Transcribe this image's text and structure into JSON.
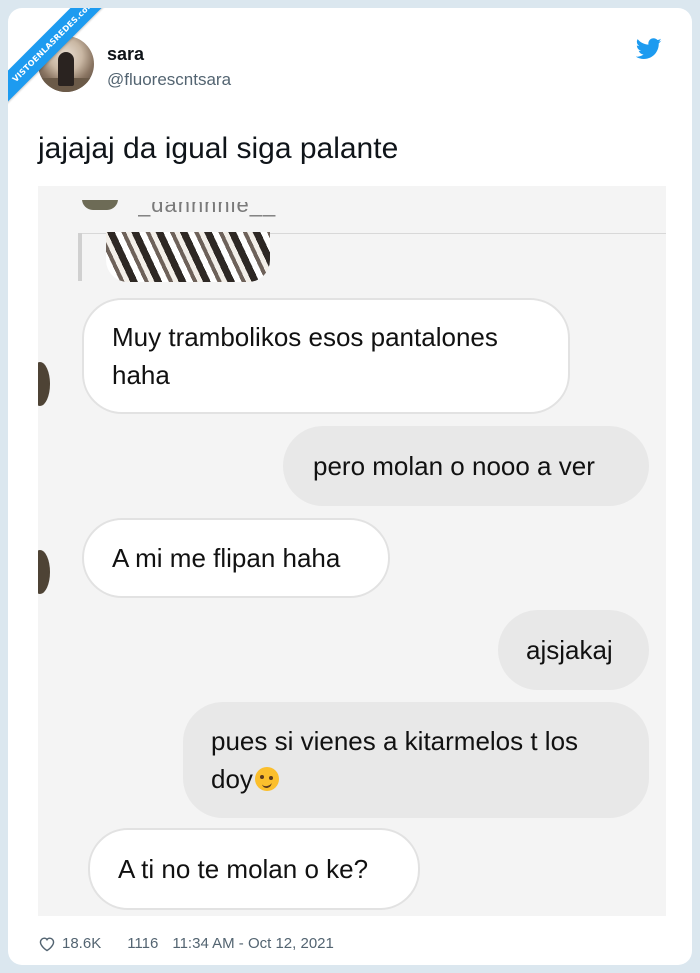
{
  "watermark": {
    "text": "VISTOENLASREDES",
    "suffix": ".com"
  },
  "tweet": {
    "author_name": "sara",
    "author_handle": "@fluorescntsara",
    "text": "jajajaj da igual siga palante",
    "likes": "18.6K",
    "replies_or_retweets": "1116",
    "timestamp": "11:34 AM - Oct 12, 2021"
  },
  "screenshot": {
    "cut_username": "_danhhhle__",
    "messages": [
      {
        "side": "received",
        "text": "Muy trambolikos esos pantalones haha"
      },
      {
        "side": "sent",
        "text": "pero molan o nooo a ver"
      },
      {
        "side": "received",
        "text": "A mi me flipan haha"
      },
      {
        "side": "sent",
        "text": "ajsjakaj"
      },
      {
        "side": "sent",
        "text": "pues si vienes a kitarmelos t los doy",
        "emoji": "woozy-face"
      },
      {
        "side": "received",
        "text": "A ti no te molan o ke?"
      }
    ]
  },
  "colors": {
    "twitter_blue": "#1d9bf0",
    "background": "#dbe7ef",
    "sent_bubble": "#e8e8e8",
    "received_bubble": "#ffffff"
  }
}
